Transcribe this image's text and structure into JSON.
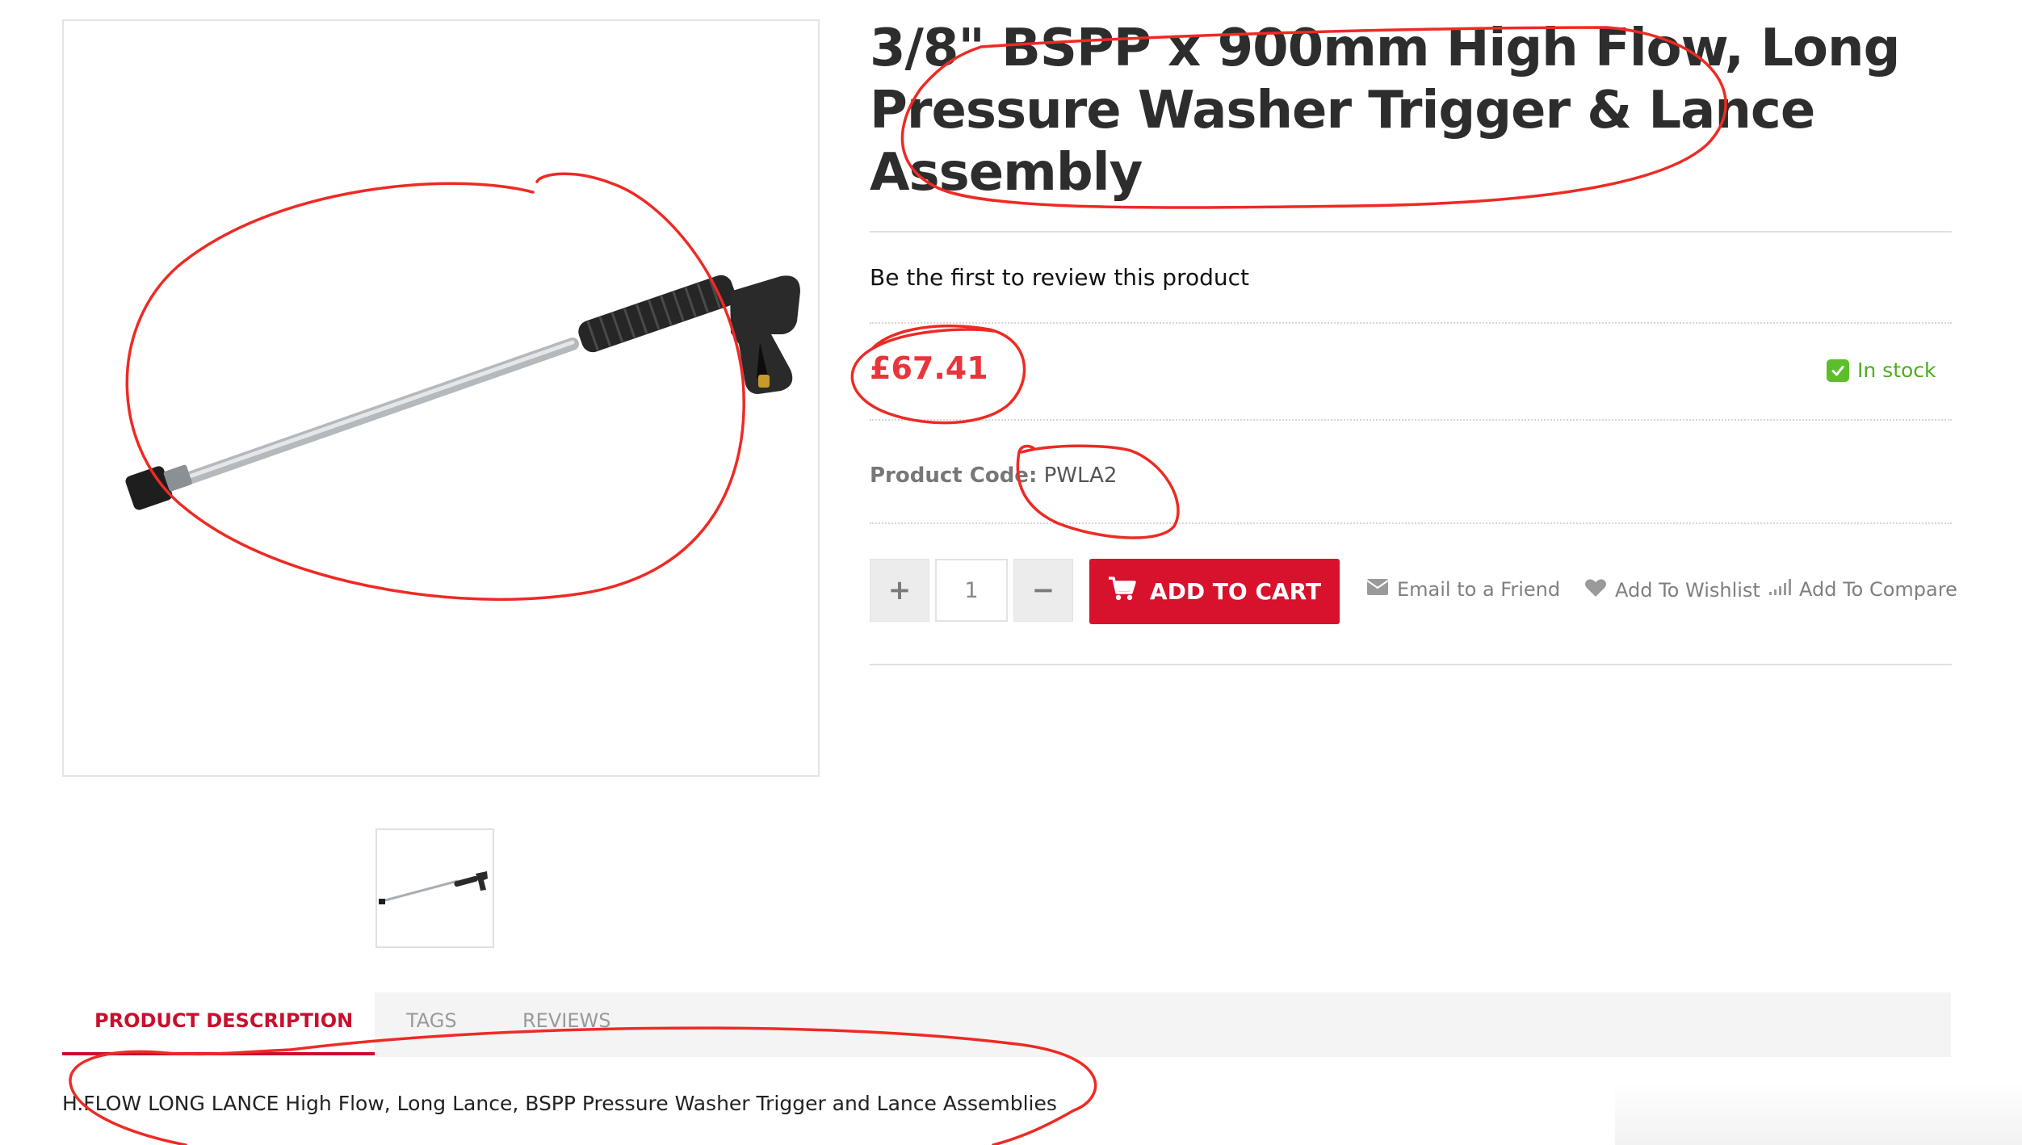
{
  "product": {
    "title_line1": "3/8\" BSPP x 900mm High Flow, Long",
    "title_line2": "Pressure Washer Trigger & Lance",
    "title_line3": "Assembly",
    "review_link": "Be the first to review this product",
    "price": "£67.41",
    "stock_status": "In stock",
    "code_label": "Product Code:",
    "code_value": "PWLA2"
  },
  "purchase": {
    "plus_label": "+",
    "minus_label": "−",
    "quantity": "1",
    "add_to_cart": "ADD TO CART"
  },
  "actions": {
    "email": "Email to a Friend",
    "wishlist": "Add To Wishlist",
    "compare": "Add To Compare"
  },
  "tabs": [
    {
      "label": "PRODUCT DESCRIPTION",
      "active": true
    },
    {
      "label": "TAGS",
      "active": false
    },
    {
      "label": "REVIEWS",
      "active": false
    }
  ],
  "description": "H.FLOW LONG LANCE High Flow, Long Lance, BSPP Pressure Washer Trigger and Lance Assemblies",
  "icons": {
    "cart": "cart-icon",
    "email": "envelope-icon",
    "wishlist": "heart-icon",
    "compare": "bar-chart-icon",
    "stock": "check-icon"
  },
  "colors": {
    "accent_red": "#d8112c",
    "price_red": "#e8353b",
    "stock_green": "#4cae1e",
    "annotation_red": "#ee2a24"
  }
}
